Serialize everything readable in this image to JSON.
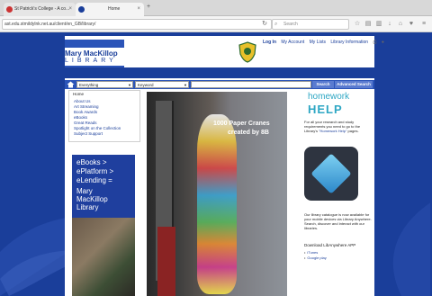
{
  "browser": {
    "tabs": [
      {
        "label": "St Patrick's College - A co...",
        "close": "×"
      },
      {
        "label": "Home",
        "close": "×"
      }
    ],
    "new_tab": "+",
    "url": "ast.edu.stmildylnk.net.au/client/en_GB/library/",
    "search_placeholder": "Search"
  },
  "site": {
    "logo_line1": "Mary MacKillop",
    "logo_line2": "LIBRARY",
    "top_nav": [
      "Log In",
      "My Account",
      "My Lists",
      "Library Information"
    ],
    "search": {
      "scope_select": "Everything",
      "field_select": "Keyword",
      "search_button": "Search",
      "advanced_button": "Advanced Search"
    },
    "menu": {
      "home": "Home",
      "items": [
        "About Us",
        "Art Streaming",
        "Book Awards",
        "eBooks",
        "Great Reads",
        "Spotlight on the Collection",
        "Subject Support"
      ]
    },
    "ebooks_panel": {
      "lines": [
        "eBooks >",
        "ePlatform >",
        "eLending =",
        "Mary",
        "MacKillop",
        "Library"
      ]
    },
    "photo_caption": {
      "line1": "1000 Paper Cranes",
      "line2": "created by 8B"
    },
    "homework": {
      "title1": "homework",
      "title2": "HELP",
      "text": "For all your research and study requirements you need to go to the Library's",
      "link": "\"Homework Help\"",
      "text_end": "pages."
    },
    "app_text": "Our library catalogue is now available for your mobile devices via Library Anywhere. Search, discover and interact with our libraries.",
    "download_title": "Download LibAnywhere APP",
    "downloads": [
      "iTunes",
      "Google play"
    ]
  },
  "colors": {
    "brand_blue": "#1a3e9a",
    "accent_teal": "#2ea7c4"
  }
}
